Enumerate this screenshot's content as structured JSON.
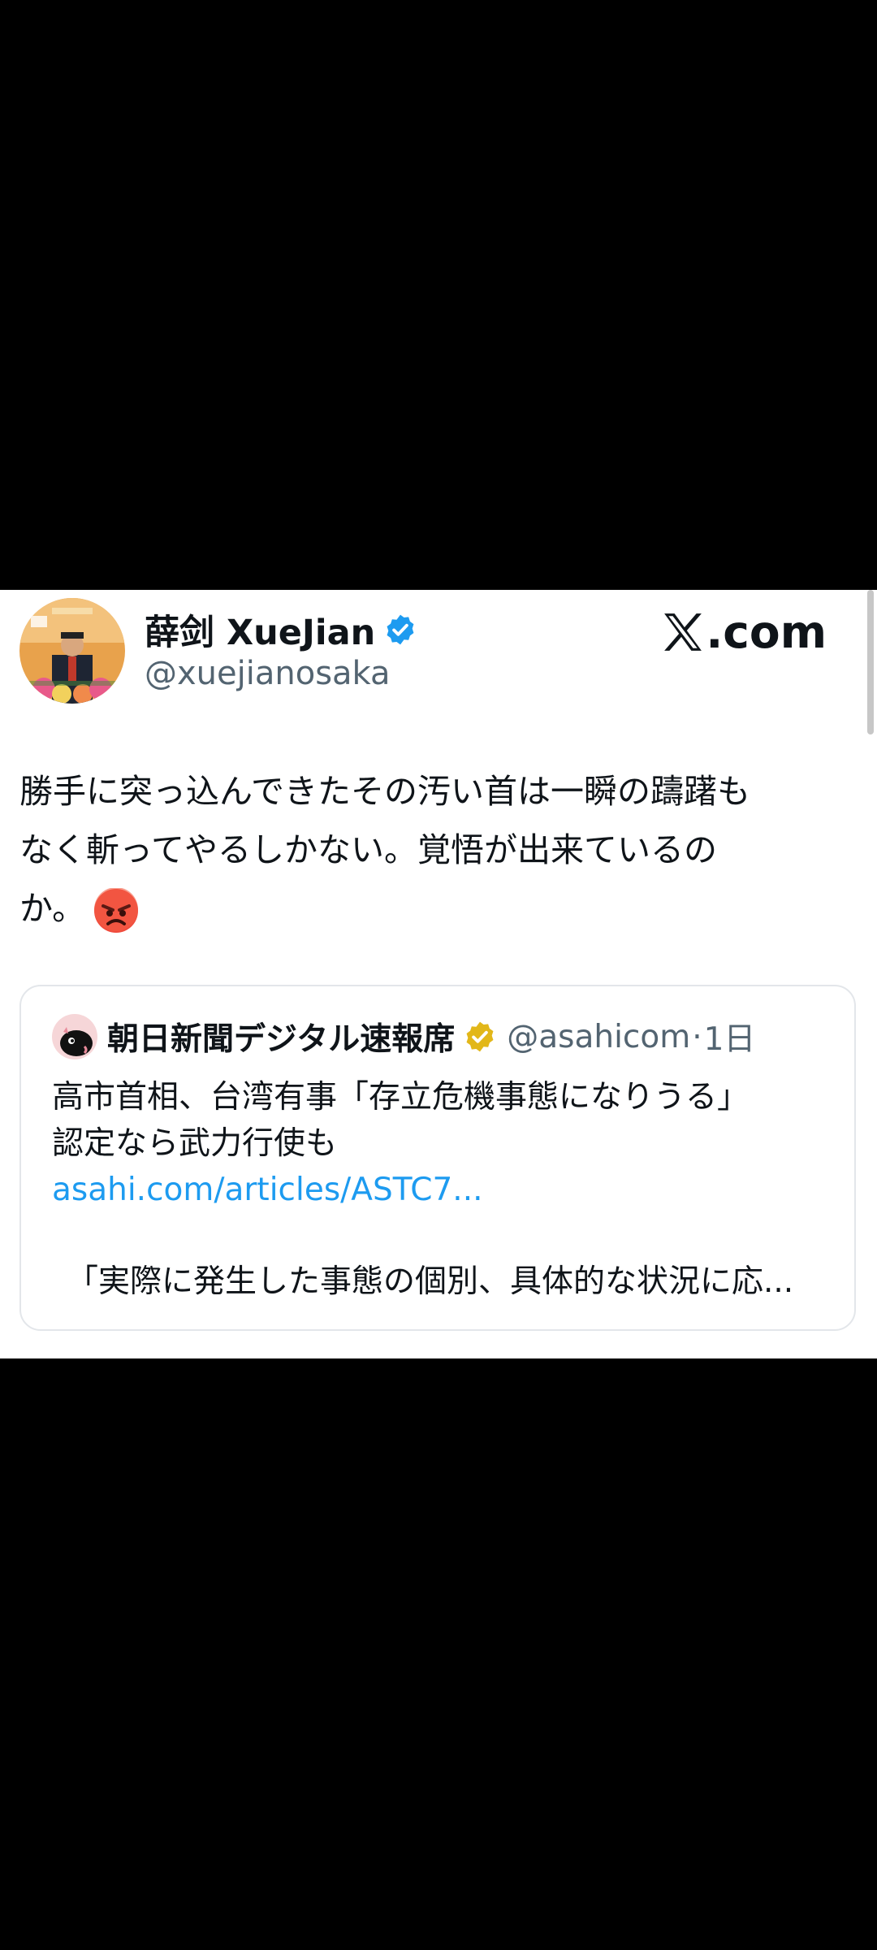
{
  "tweet_card": {
    "author_name": "薛剑 XueJian",
    "author_handle": "@xuejianosaka",
    "site_label": ".com",
    "body_lines": [
      "勝手に突っ込んできたその汚い首は一瞬の躊躇も",
      "なく斬ってやるしかない。覚悟が出来ているの",
      "か。"
    ],
    "emoji": "angry-face-emoji",
    "quote": {
      "source_name": "朝日新聞デジタル速報席",
      "source_handle": "@asahicom",
      "separator": "·",
      "time": "1日",
      "text_lines": [
        "高市首相、台湾有事「存立危機事態になりうる」",
        "認定なら武力行使も"
      ],
      "link": "asahi.com/articles/ASTC7...",
      "excerpt": "「実際に発生した事態の個別、具体的な状況に応..."
    }
  },
  "colors": {
    "background": "#000000",
    "card": "#ffffff",
    "text": "#0f1419",
    "secondary_text": "#536471",
    "link": "#1d9bf0",
    "verified_blue": "#1d9bf0",
    "verified_gold": "#e2b719"
  }
}
